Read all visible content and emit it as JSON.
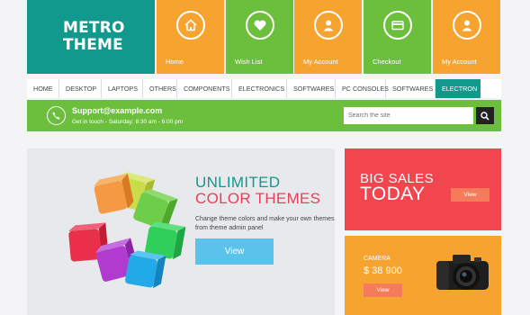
{
  "logo": {
    "line1": "METRO",
    "line2": "THEME"
  },
  "tiles": [
    {
      "label": "Home",
      "icon": "home-icon",
      "color": "#f6a42f"
    },
    {
      "label": "Wish List",
      "icon": "heart-icon",
      "color": "#6cbf3c"
    },
    {
      "label": "My Account",
      "icon": "user-icon",
      "color": "#f6a42f"
    },
    {
      "label": "Checkout",
      "icon": "credit-card-icon",
      "color": "#6cbf3c"
    },
    {
      "label": "My Account",
      "icon": "user-icon",
      "color": "#f6a42f"
    }
  ],
  "nav": {
    "items": [
      "HOME",
      "DESKTOP",
      "LAPTOPS",
      "OTHERS",
      "COMPONENTS",
      "ELECTRONICS",
      "SOFTWARES",
      "PC CONSOLES",
      "SOFTWARES",
      "ELECTRON"
    ],
    "active_index": 9
  },
  "support": {
    "email": "Support@example.com",
    "hours": "Get in touch - Saturday: 8:30 am - 6:00 pm",
    "search_placeholder": "Search the site"
  },
  "hero": {
    "title_line1": "UNLIMITED",
    "title_line2": "COLOR THEMES",
    "description": "Change theme colors and make your own themes from theme admin panel",
    "button": "View"
  },
  "sales": {
    "line1": "BIG SALES",
    "line2": "TODAY",
    "button": "View"
  },
  "camera": {
    "label": "CAMERA",
    "price": "$ 38 900",
    "button": "View"
  },
  "colors": {
    "teal": "#12998e",
    "orange": "#f6a42f",
    "green": "#6cbf3c",
    "red": "#f2464f",
    "blue": "#5bc3eb",
    "pink": "#e5405c"
  }
}
